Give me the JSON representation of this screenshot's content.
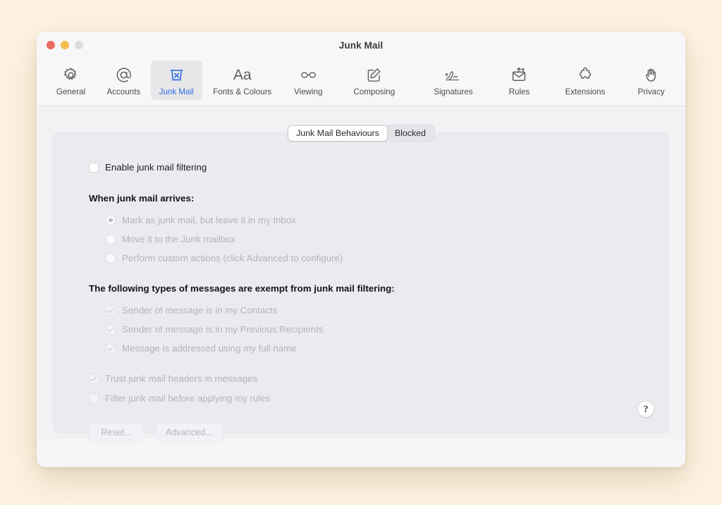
{
  "window": {
    "title": "Junk Mail",
    "traffic_lights": [
      {
        "name": "close",
        "color": "#ed6a5e"
      },
      {
        "name": "minimize",
        "color": "#f4bd4f"
      },
      {
        "name": "zoom",
        "color": "#dcdcdc"
      }
    ]
  },
  "toolbar": {
    "items": [
      {
        "label": "General",
        "icon": "gear-icon",
        "selected": false
      },
      {
        "label": "Accounts",
        "icon": "at-sign-icon",
        "selected": false
      },
      {
        "label": "Junk Mail",
        "icon": "junk-bin-icon",
        "selected": true
      },
      {
        "label": "Fonts & Colours",
        "icon": "aa-text-icon",
        "selected": false
      },
      {
        "label": "Viewing",
        "icon": "glasses-icon",
        "selected": false
      },
      {
        "label": "Composing",
        "icon": "compose-pen-icon",
        "selected": false
      },
      {
        "label": "Signatures",
        "icon": "signature-icon",
        "selected": false
      },
      {
        "label": "Rules",
        "icon": "rules-envelope-icon",
        "selected": false
      },
      {
        "label": "Extensions",
        "icon": "puzzle-icon",
        "selected": false
      },
      {
        "label": "Privacy",
        "icon": "hand-icon",
        "selected": false
      }
    ],
    "accent_color": "#2f6fe4"
  },
  "segmented_control": {
    "tabs": [
      {
        "label": "Junk Mail Behaviours",
        "selected": true
      },
      {
        "label": "Blocked",
        "selected": false
      }
    ]
  },
  "main": {
    "enable_filtering": {
      "label": "Enable junk mail filtering",
      "checked": false,
      "enabled": true
    },
    "arrives_heading": "When junk mail arrives:",
    "arrives_options": [
      {
        "label": "Mark as junk mail, but leave it in my Inbox",
        "selected": true,
        "enabled": false
      },
      {
        "label": "Move it to the Junk mailbox",
        "selected": false,
        "enabled": false
      },
      {
        "label": "Perform custom actions (click Advanced to configure)",
        "selected": false,
        "enabled": false
      }
    ],
    "exempt_heading": "The following types of messages are exempt from junk mail filtering:",
    "exempt_options": [
      {
        "label": "Sender of message is in my Contacts",
        "checked": true,
        "enabled": false
      },
      {
        "label": "Sender of message is in my Previous Recipients",
        "checked": true,
        "enabled": false
      },
      {
        "label": "Message is addressed using my full name",
        "checked": true,
        "enabled": false
      }
    ],
    "extra_options": [
      {
        "label": "Trust junk mail headers in messages",
        "checked": true,
        "enabled": false
      },
      {
        "label": "Filter junk mail before applying my rules",
        "checked": false,
        "enabled": false
      }
    ],
    "buttons": [
      {
        "label": "Reset...",
        "enabled": false
      },
      {
        "label": "Advanced...",
        "enabled": false
      }
    ],
    "help_button": {
      "label": "?",
      "name": "help-button"
    }
  }
}
